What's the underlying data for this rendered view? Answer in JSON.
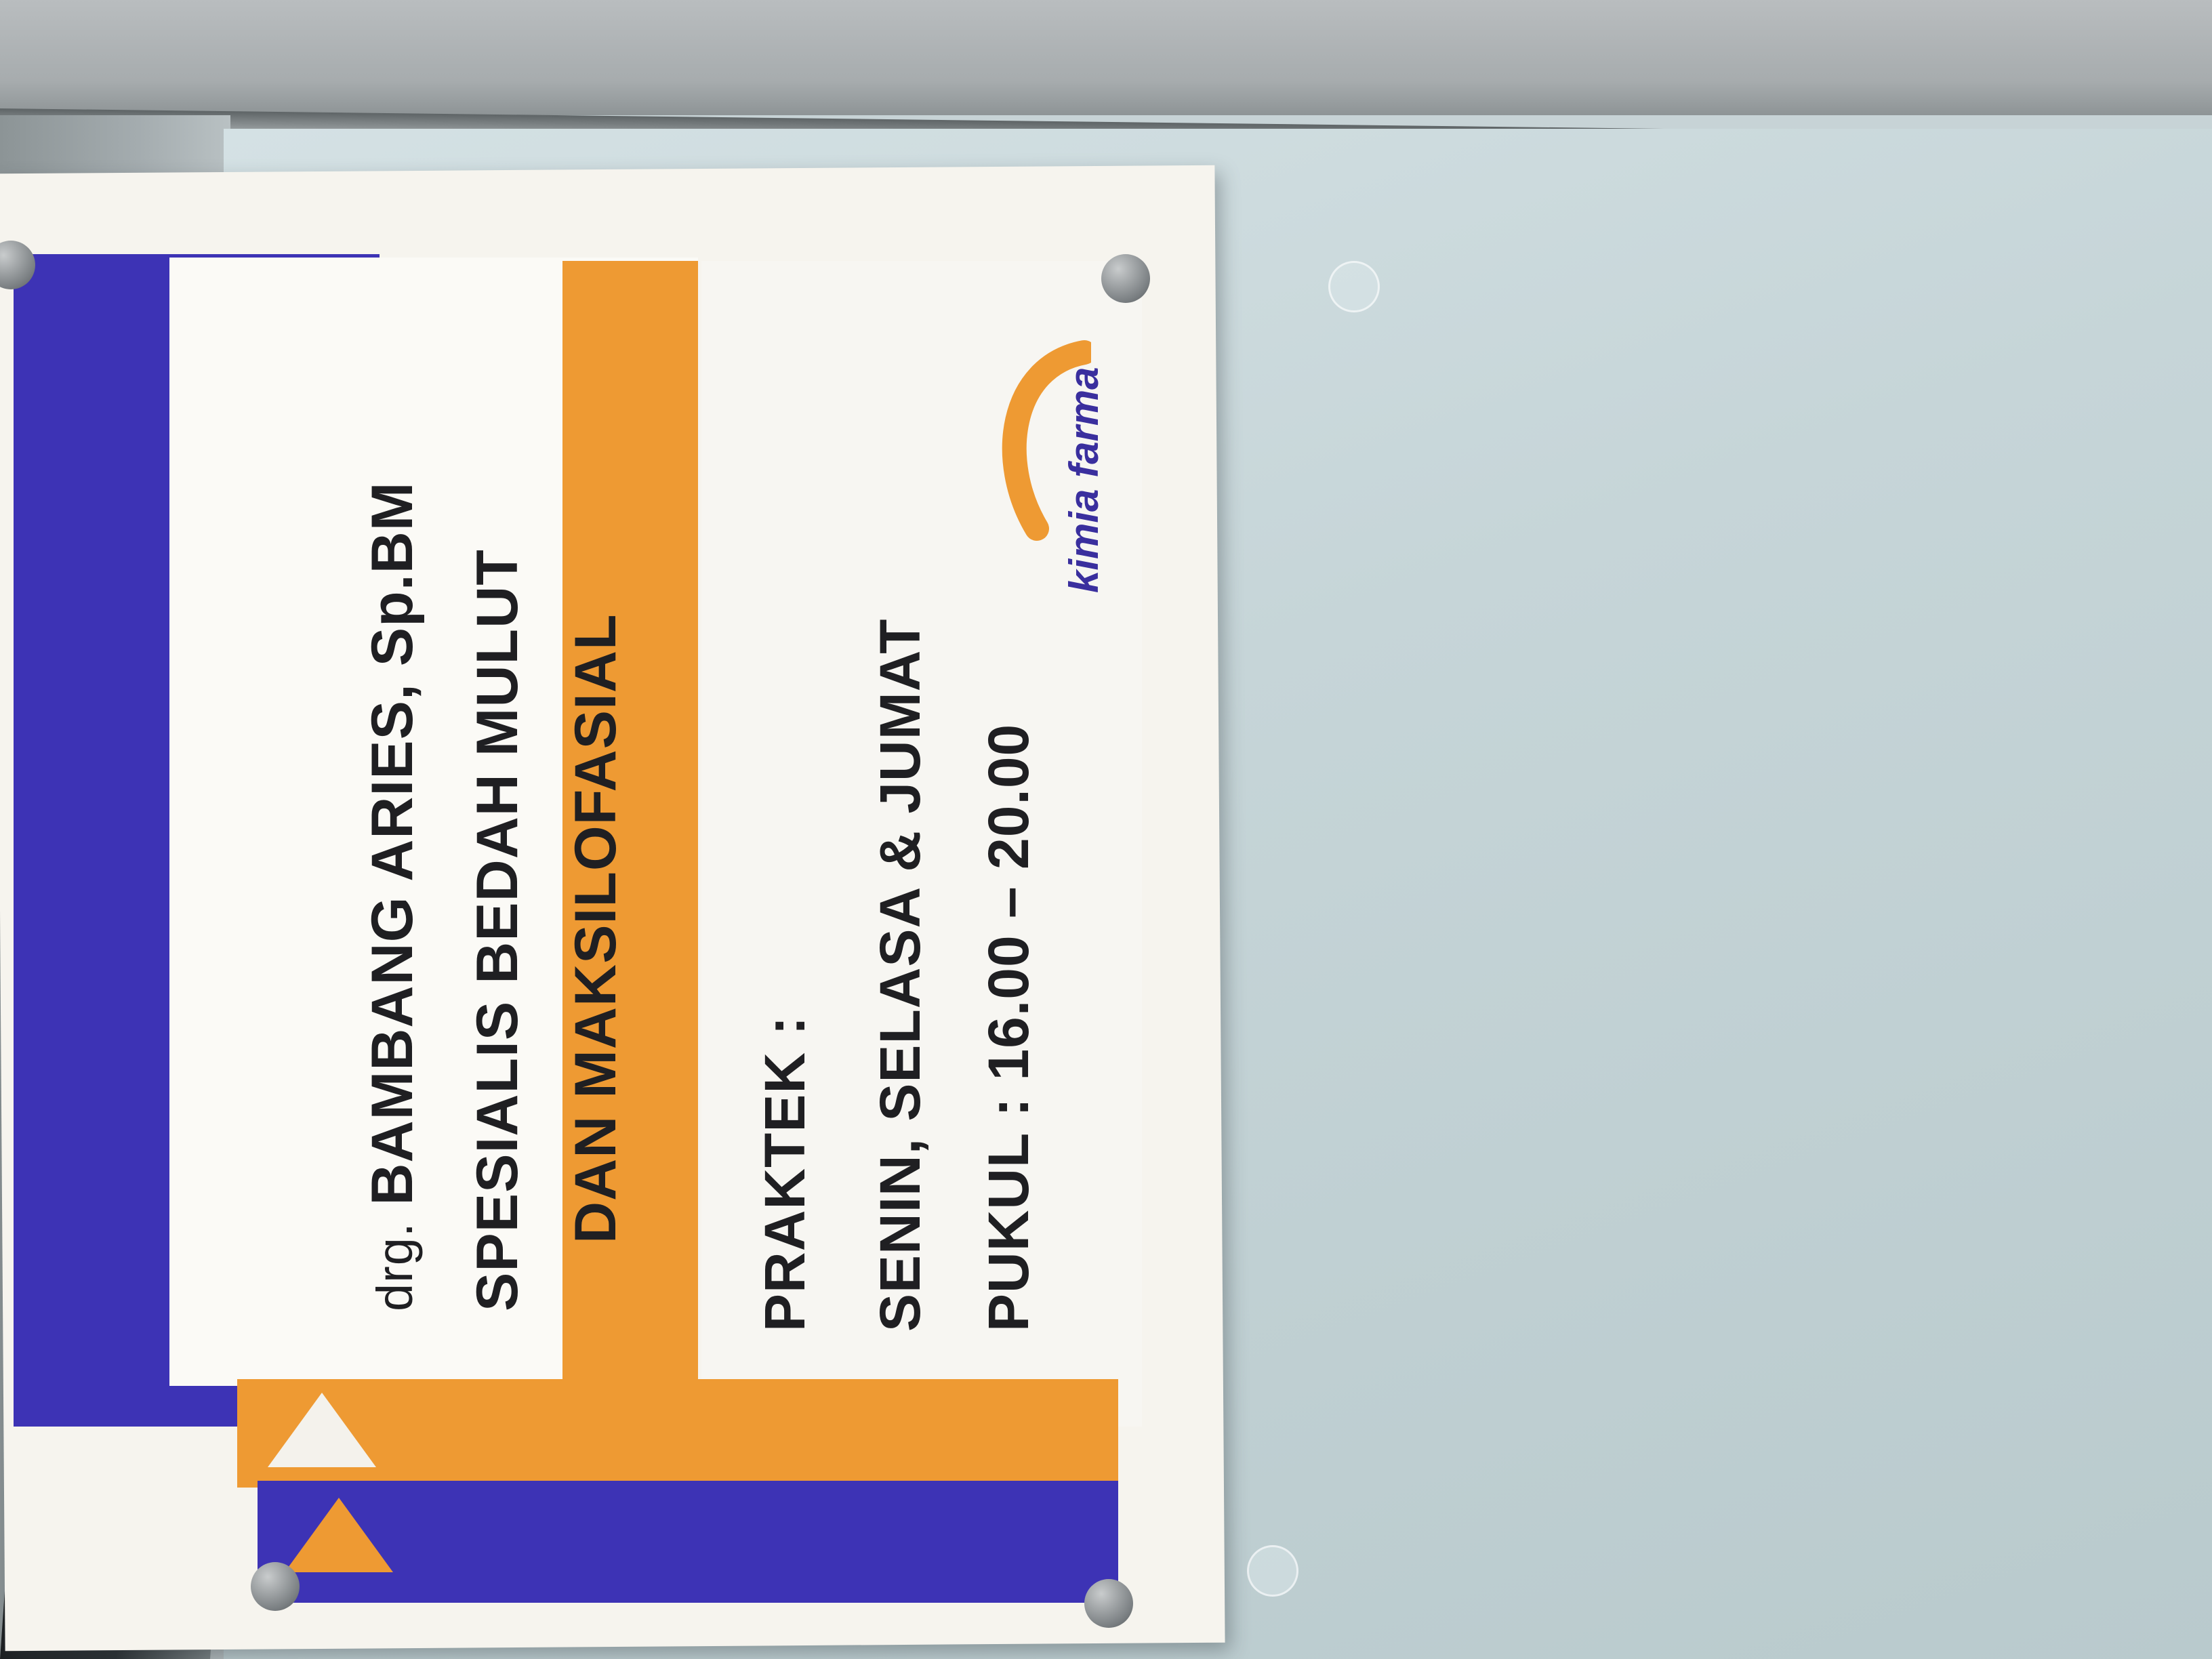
{
  "sign": {
    "name_prefix": "drg.",
    "name": "BAMBANG ARIES, Sp.BM",
    "specialty_line1": "SPESIALIS BEDAH MULUT",
    "specialty_line2": "DAN MAKSILOFASIAL",
    "practice_label": "PRAKTEK :",
    "days": "SENIN, SELASA & JUMAT",
    "hours": "PUKUL : 16.00 – 20.00",
    "logo_text": "kimia farma"
  },
  "colors": {
    "blue": "#3d33b5",
    "orange": "#ee9a33",
    "panel": "#fbfaf6",
    "background_glass": "#c7d3d6"
  }
}
